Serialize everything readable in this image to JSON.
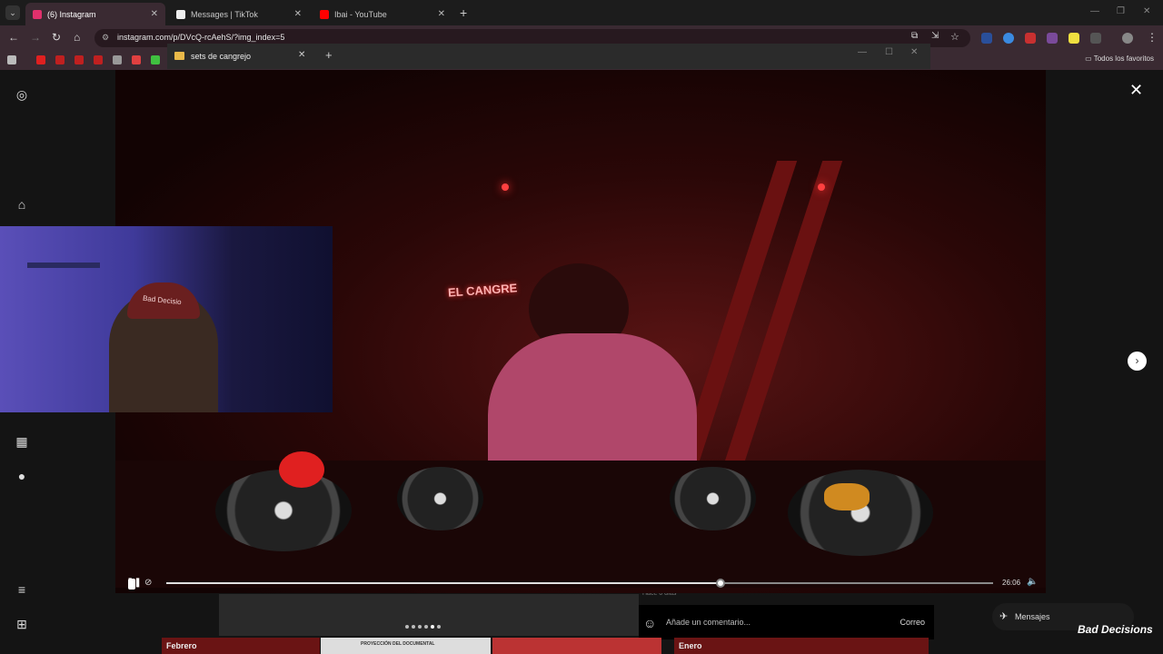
{
  "browser": {
    "tabs": [
      {
        "label": "(6) Instagram",
        "active": true,
        "icon": "instagram-icon",
        "color": "#e1306c"
      },
      {
        "label": "Messages | TikTok",
        "active": false,
        "icon": "tiktok-icon",
        "color": "#ffffff"
      },
      {
        "label": "Ibai - YouTube",
        "active": false,
        "icon": "youtube-icon",
        "color": "#ff0000"
      }
    ],
    "url": "instagram.com/p/DVcQ-rcAehS/?img_index=5",
    "bookmarks_folder": "Todos los favoritos"
  },
  "inner_window": {
    "title": "sets de cangrejo"
  },
  "video": {
    "neon_sign": "EL CANGRE",
    "webcam_cap_text": "Bad Decisio",
    "time": "26:06",
    "progress": 0.67
  },
  "post": {
    "time_ago": "Hace 6 días",
    "comment_placeholder": "Añade un comentario...",
    "post_button": "Correo",
    "messages_label": "Mensajes",
    "carousel_count": 6,
    "carousel_active": 4
  },
  "background": {
    "left_label": "Febrero",
    "right_label": "Enero",
    "doc_label": "PROYECCIÓN DEL DOCUMENTAL"
  },
  "brand_watermark": "Bad Decisions"
}
